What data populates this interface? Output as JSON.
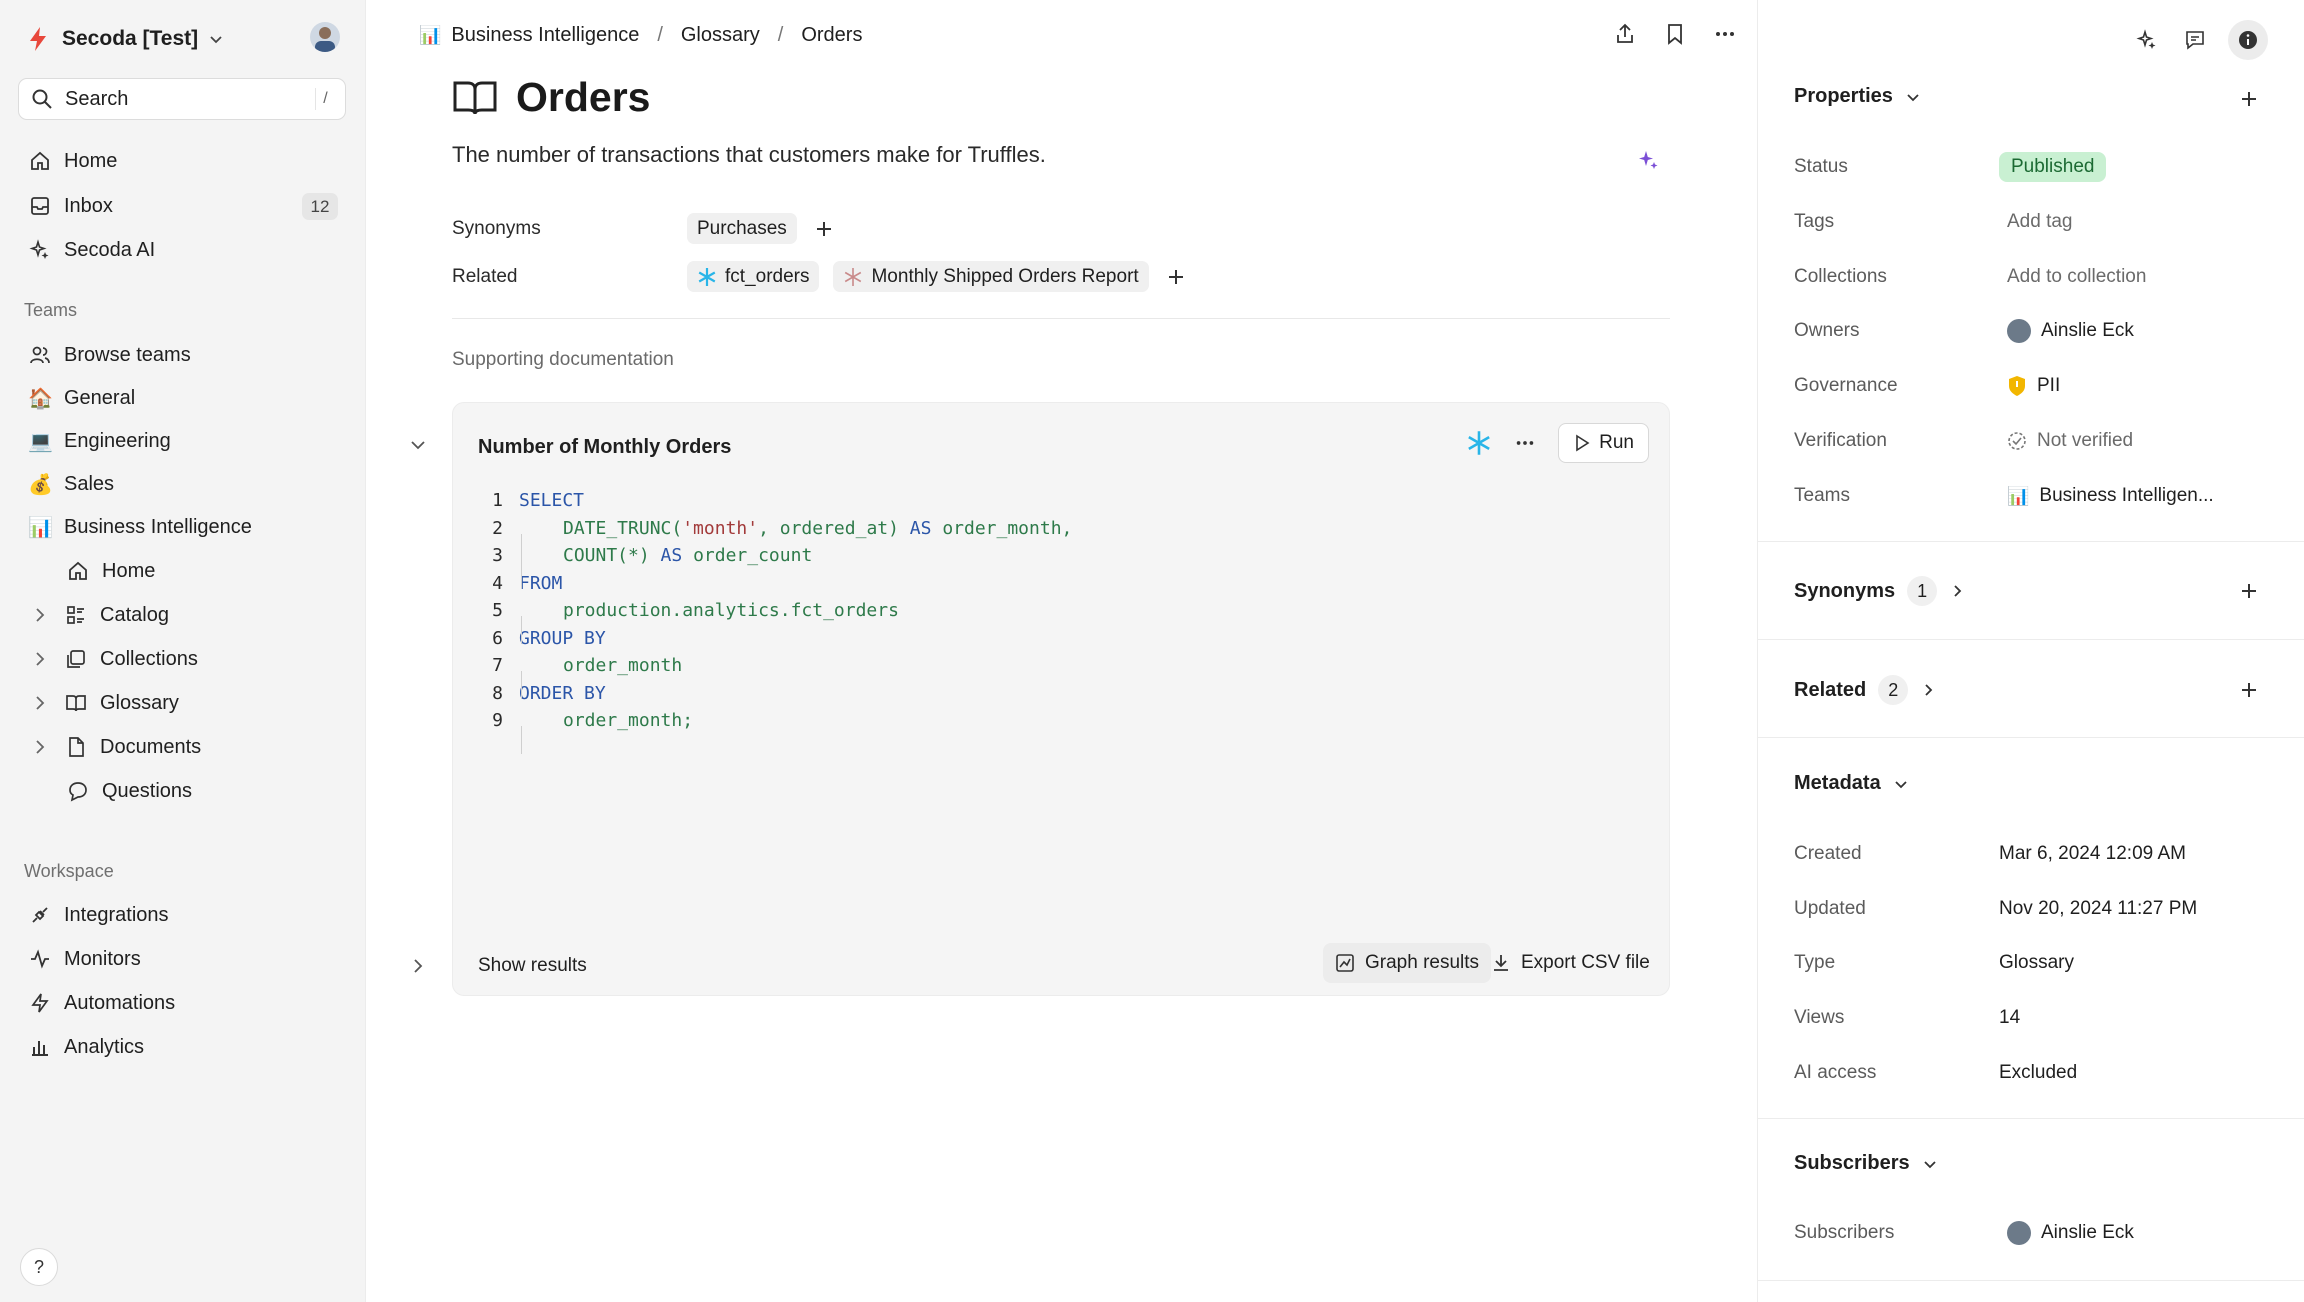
{
  "workspace": {
    "name": "Secoda [Test]"
  },
  "search": {
    "placeholder": "Search",
    "shortcut": "/"
  },
  "nav": {
    "home": "Home",
    "inbox": "Inbox",
    "inbox_count": "12",
    "ai": "Secoda AI"
  },
  "teams": {
    "label": "Teams",
    "browse": "Browse teams",
    "items": [
      {
        "label": "General",
        "emoji": "🏠"
      },
      {
        "label": "Engineering",
        "emoji": "💻"
      },
      {
        "label": "Sales",
        "emoji": "💰"
      },
      {
        "label": "Business Intelligence",
        "emoji": "📊"
      }
    ],
    "bi_children": [
      "Home",
      "Catalog",
      "Collections",
      "Glossary",
      "Documents",
      "Questions"
    ]
  },
  "workspace_section": {
    "label": "Workspace",
    "items": [
      "Integrations",
      "Monitors",
      "Automations",
      "Analytics"
    ]
  },
  "help": "?",
  "breadcrumb": [
    "Business Intelligence",
    "Glossary",
    "Orders"
  ],
  "page": {
    "title": "Orders",
    "description": "The number of transactions that customers make for Truffles.",
    "synonyms_label": "Synonyms",
    "synonyms": [
      "Purchases"
    ],
    "related_label": "Related",
    "related": [
      "fct_orders",
      "Monthly Shipped Orders Report"
    ],
    "supporting": "Supporting documentation"
  },
  "query": {
    "title": "Number of Monthly Orders",
    "run": "Run",
    "show_results": "Show results",
    "graph": "Graph results",
    "export": "Export CSV file",
    "lines": [
      {
        "n": "1",
        "tokens": [
          [
            "kw",
            "SELECT"
          ]
        ]
      },
      {
        "n": "2",
        "indent": true,
        "tokens": [
          [
            "fn",
            "DATE_TRUNC("
          ],
          [
            "str",
            "'month'"
          ],
          [
            "fn",
            ", ordered_at) "
          ],
          [
            "kw",
            "AS"
          ],
          [
            "id",
            " order_month,"
          ]
        ]
      },
      {
        "n": "3",
        "indent": true,
        "tokens": [
          [
            "fn",
            "COUNT(*) "
          ],
          [
            "kw",
            "AS"
          ],
          [
            "id",
            " order_count"
          ]
        ]
      },
      {
        "n": "4",
        "tokens": [
          [
            "kw",
            "FROM"
          ]
        ]
      },
      {
        "n": "5",
        "indent": true,
        "tokens": [
          [
            "id",
            "production.analytics.fct_orders"
          ]
        ]
      },
      {
        "n": "6",
        "tokens": [
          [
            "kw",
            "GROUP BY"
          ]
        ]
      },
      {
        "n": "7",
        "indent": true,
        "tokens": [
          [
            "id",
            "order_month"
          ]
        ]
      },
      {
        "n": "8",
        "tokens": [
          [
            "kw",
            "ORDER BY"
          ]
        ]
      },
      {
        "n": "9",
        "indent": true,
        "tokens": [
          [
            "id",
            "order_month;"
          ]
        ]
      }
    ]
  },
  "properties": {
    "header": "Properties",
    "status_k": "Status",
    "status_v": "Published",
    "tags_k": "Tags",
    "tags_v": "Add tag",
    "collections_k": "Collections",
    "collections_v": "Add to collection",
    "owners_k": "Owners",
    "owners_v": "Ainslie Eck",
    "gov_k": "Governance",
    "gov_v": "PII",
    "ver_k": "Verification",
    "ver_v": "Not verified",
    "teams_k": "Teams",
    "teams_v": "Business Intelligen..."
  },
  "synonyms_panel": {
    "label": "Synonyms",
    "count": "1"
  },
  "related_panel": {
    "label": "Related",
    "count": "2"
  },
  "metadata": {
    "header": "Metadata",
    "created_k": "Created",
    "created_v": "Mar 6, 2024 12:09 AM",
    "updated_k": "Updated",
    "updated_v": "Nov 20, 2024 11:27 PM",
    "type_k": "Type",
    "type_v": "Glossary",
    "views_k": "Views",
    "views_v": "14",
    "ai_k": "AI access",
    "ai_v": "Excluded"
  },
  "subscribers": {
    "header": "Subscribers",
    "k": "Subscribers",
    "v": "Ainslie Eck"
  },
  "colors": {
    "accent_published": "#c9f0d2",
    "brand_logo": "#e8473b",
    "snowflake": "#29b5e8",
    "ai_purple": "#7b4fd6"
  }
}
